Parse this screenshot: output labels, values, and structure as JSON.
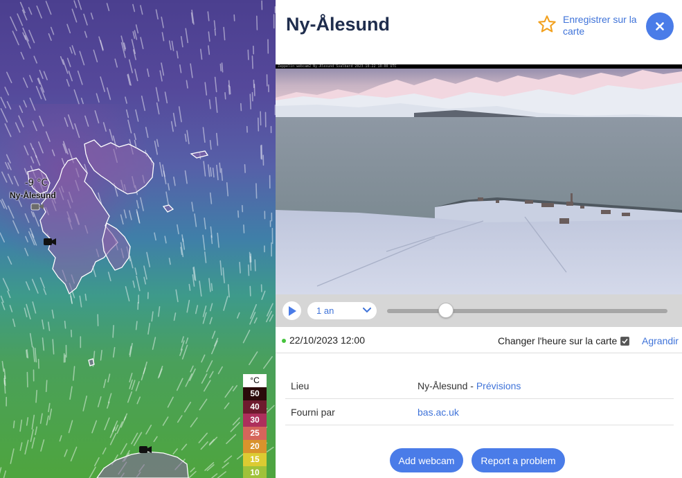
{
  "map": {
    "temperature_label": "-9 °C",
    "place_label": "Ny-Ålesund",
    "legend": {
      "unit": "°C",
      "items": [
        {
          "value": "50",
          "color": "#2a0a0a"
        },
        {
          "value": "40",
          "color": "#6e1a2e"
        },
        {
          "value": "30",
          "color": "#ad2f5c"
        },
        {
          "value": "25",
          "color": "#d5655b"
        },
        {
          "value": "20",
          "color": "#d9932c"
        },
        {
          "value": "15",
          "color": "#dccb32"
        },
        {
          "value": "10",
          "color": "#9fc23a"
        }
      ]
    }
  },
  "panel": {
    "title": "Ny-Ålesund",
    "save_label": "Enregistrer sur la carte",
    "webcam_caption": "Zeppelin webcam2 Ny-Ålesund Svalbard 2023-10-22 10:00 UTC",
    "controls": {
      "range_selected": "1 an",
      "slider_fraction": 0.21
    },
    "status": {
      "datetime": "22/10/2023 12:00",
      "change_time_label": "Changer l'heure sur la carte",
      "change_time_checked": true,
      "expand_label": "Agrandir"
    },
    "info": {
      "location_label": "Lieu",
      "location_value": "Ny-Ålesund",
      "location_separator": " - ",
      "forecast_link": "Prévisions",
      "provider_label": "Fourni par",
      "provider_value": "bas.ac.uk"
    },
    "buttons": {
      "add_webcam": "Add webcam",
      "report_problem": "Report a problem"
    }
  },
  "colors": {
    "accent": "#4a7ce8",
    "link": "#3f73d9",
    "title": "#1f2d4d",
    "star": "#f2a11f",
    "status_dot": "#46c33d"
  }
}
